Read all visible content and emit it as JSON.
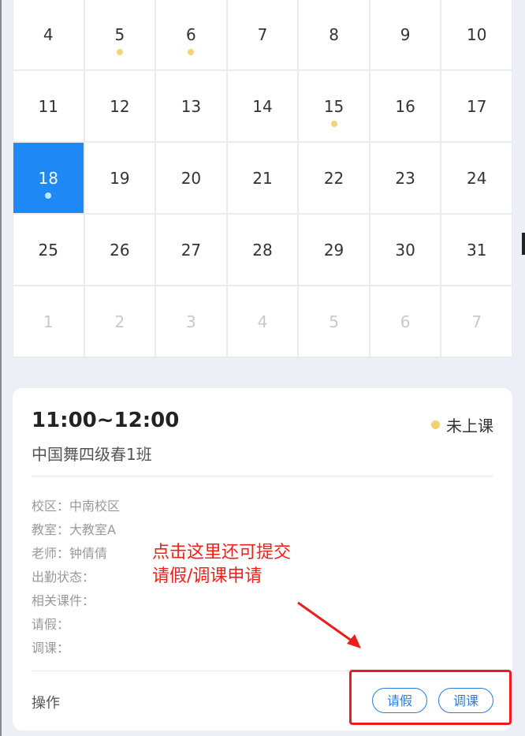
{
  "calendar": {
    "weeks": [
      [
        {
          "d": ""
        },
        {
          "d": ""
        },
        {
          "d": ""
        },
        {
          "d": ""
        },
        {
          "d": ""
        },
        {
          "d": ""
        },
        {
          "d": ""
        }
      ],
      [
        {
          "d": "4"
        },
        {
          "d": "5",
          "dot": true
        },
        {
          "d": "6",
          "dot": true
        },
        {
          "d": "7"
        },
        {
          "d": "8"
        },
        {
          "d": "9"
        },
        {
          "d": "10"
        }
      ],
      [
        {
          "d": "11"
        },
        {
          "d": "12"
        },
        {
          "d": "13"
        },
        {
          "d": "14"
        },
        {
          "d": "15",
          "dot": true
        },
        {
          "d": "16"
        },
        {
          "d": "17"
        }
      ],
      [
        {
          "d": "18",
          "dot": true,
          "selected": true
        },
        {
          "d": "19"
        },
        {
          "d": "20"
        },
        {
          "d": "21"
        },
        {
          "d": "22"
        },
        {
          "d": "23"
        },
        {
          "d": "24"
        }
      ],
      [
        {
          "d": "25"
        },
        {
          "d": "26"
        },
        {
          "d": "27"
        },
        {
          "d": "28"
        },
        {
          "d": "29"
        },
        {
          "d": "30"
        },
        {
          "d": "31"
        }
      ],
      [
        {
          "d": "1",
          "other": true
        },
        {
          "d": "2",
          "other": true
        },
        {
          "d": "3",
          "other": true
        },
        {
          "d": "4",
          "other": true
        },
        {
          "d": "5",
          "other": true
        },
        {
          "d": "6",
          "other": true
        },
        {
          "d": "7",
          "other": true
        }
      ]
    ],
    "colors": {
      "selected": "#1e88f5",
      "dot": "#f7d27a"
    }
  },
  "course": {
    "time": "11:00~12:00",
    "status": "未上课",
    "status_color": "#f5d06e",
    "class_name": "中国舞四级春1班",
    "info": [
      {
        "label": "校区：",
        "value": "中南校区"
      },
      {
        "label": "教室：",
        "value": "大教室A"
      },
      {
        "label": "老师：",
        "value": "钟倩倩"
      },
      {
        "label": "出勤状态：",
        "value": ""
      },
      {
        "label": "相关课件：",
        "value": ""
      },
      {
        "label": "请假：",
        "value": ""
      },
      {
        "label": "调课：",
        "value": ""
      }
    ],
    "ops_label": "操作",
    "leave_button": "请假",
    "adjust_button": "调课"
  },
  "annotation": {
    "line1": "点击这里还可提交",
    "line2": "请假/调课申请",
    "color": "#f0201b"
  }
}
